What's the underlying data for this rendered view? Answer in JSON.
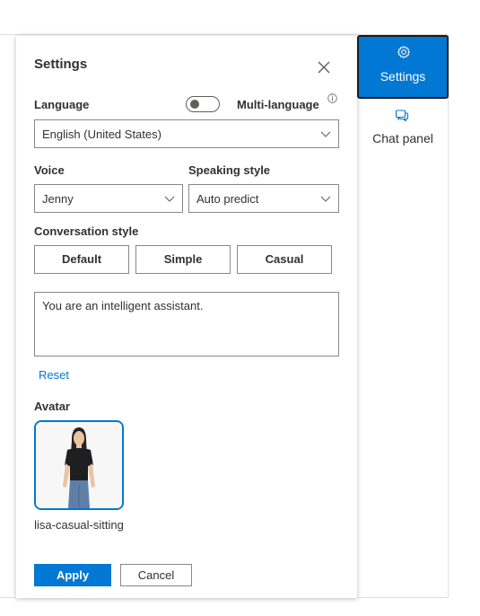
{
  "panel": {
    "title": "Settings",
    "language_label": "Language",
    "multi_language_label": "Multi-language",
    "multi_language_enabled": false,
    "language_value": "English (United States)",
    "voice_label": "Voice",
    "voice_value": "Jenny",
    "speaking_style_label": "Speaking style",
    "speaking_style_value": "Auto predict",
    "conversation_style_label": "Conversation style",
    "conversation_styles": [
      "Default",
      "Simple",
      "Casual"
    ],
    "system_prompt": "You are an intelligent assistant.",
    "reset_label": "Reset",
    "avatar_label": "Avatar",
    "avatar_name": "lisa-casual-sitting",
    "apply_label": "Apply",
    "cancel_label": "Cancel"
  },
  "side_nav": {
    "settings_label": "Settings",
    "chat_panel_label": "Chat panel"
  },
  "colors": {
    "accent": "#0078d4",
    "text": "#323130",
    "border": "#8a8886"
  },
  "icons": [
    "close-icon",
    "info-icon",
    "chevron-down-icon",
    "gear-icon",
    "chat-icon"
  ]
}
